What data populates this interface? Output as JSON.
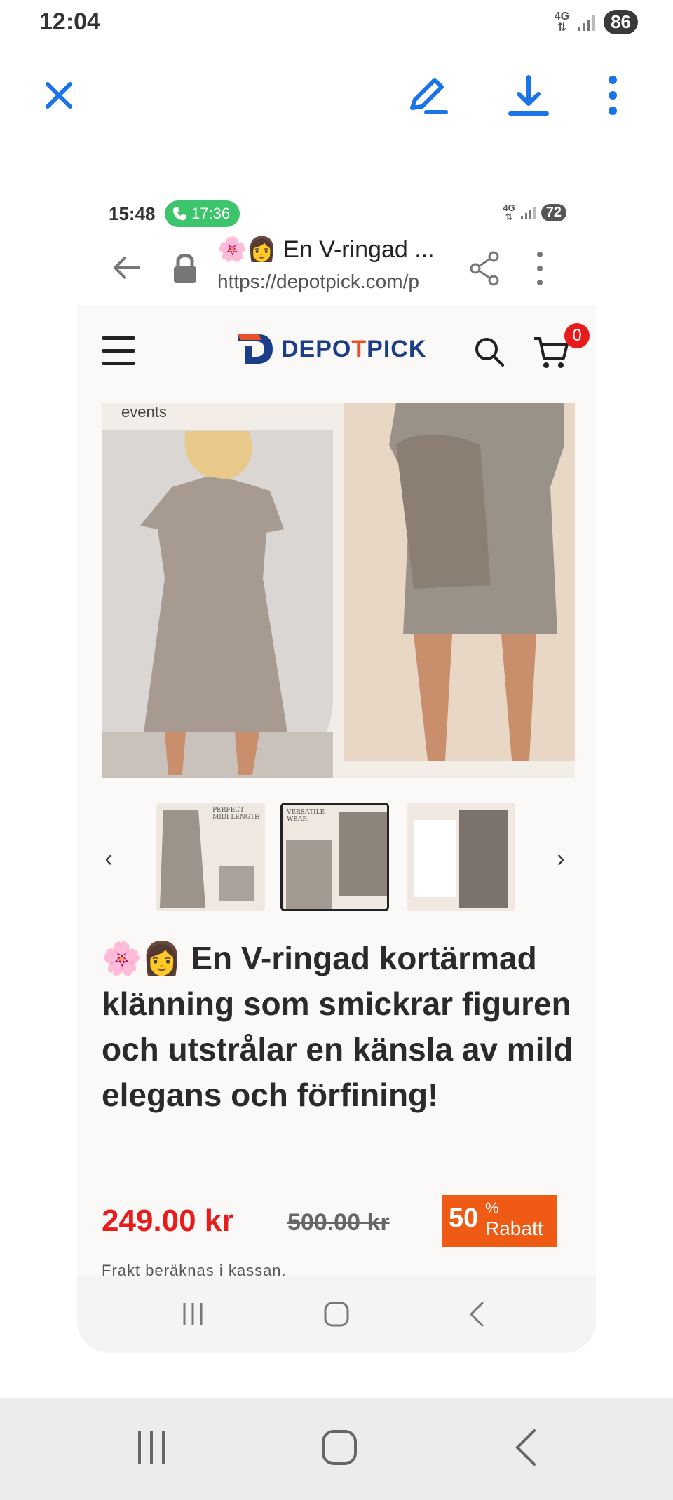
{
  "status_bar": {
    "time": "12:04",
    "network": "4G",
    "battery": "86"
  },
  "toolbar": {
    "close": "close",
    "edit": "edit",
    "download": "download",
    "more": "more"
  },
  "inner_status": {
    "time": "15:48",
    "call_time": "17:36",
    "network": "4G",
    "battery": "72"
  },
  "browser": {
    "tab_title": "🌸👩 En V-ringad ...",
    "url": "https://depotpick.com/p"
  },
  "site": {
    "logo_main": "DEPO",
    "logo_accent": "T",
    "logo_end": "PICK",
    "cart_count": "0",
    "image_caption": "events",
    "thumb_labels": [
      "PERFECT MIDI LENGTH",
      "VERSATILE WEAR"
    ],
    "product_title": "🌸👩 En V-ringad kortärmad klänning som smickrar figuren och utstrålar en känsla av mild elegans och förfining!",
    "price": "249.00 kr",
    "old_price": "500.00 kr",
    "discount_value": "50",
    "discount_percent": "%",
    "discount_label": "Rabatt",
    "shipping_note": "Frakt beräknas i kassan.",
    "prev_arrow": "‹",
    "next_arrow": "›"
  },
  "colors": {
    "accent_blue": "#1a73e8",
    "price_red": "#e81c1c",
    "discount_orange": "#ef5a14",
    "call_green": "#3cc56a",
    "logo_blue": "#1c3d8a",
    "logo_orange": "#e8512a"
  },
  "icons": [
    "close-icon",
    "pen-icon",
    "download-icon",
    "more-vert-icon",
    "back-arrow-icon",
    "lock-icon",
    "share-icon",
    "menu-icon",
    "search-icon",
    "cart-icon",
    "recents-icon",
    "home-icon",
    "nav-back-icon"
  ]
}
